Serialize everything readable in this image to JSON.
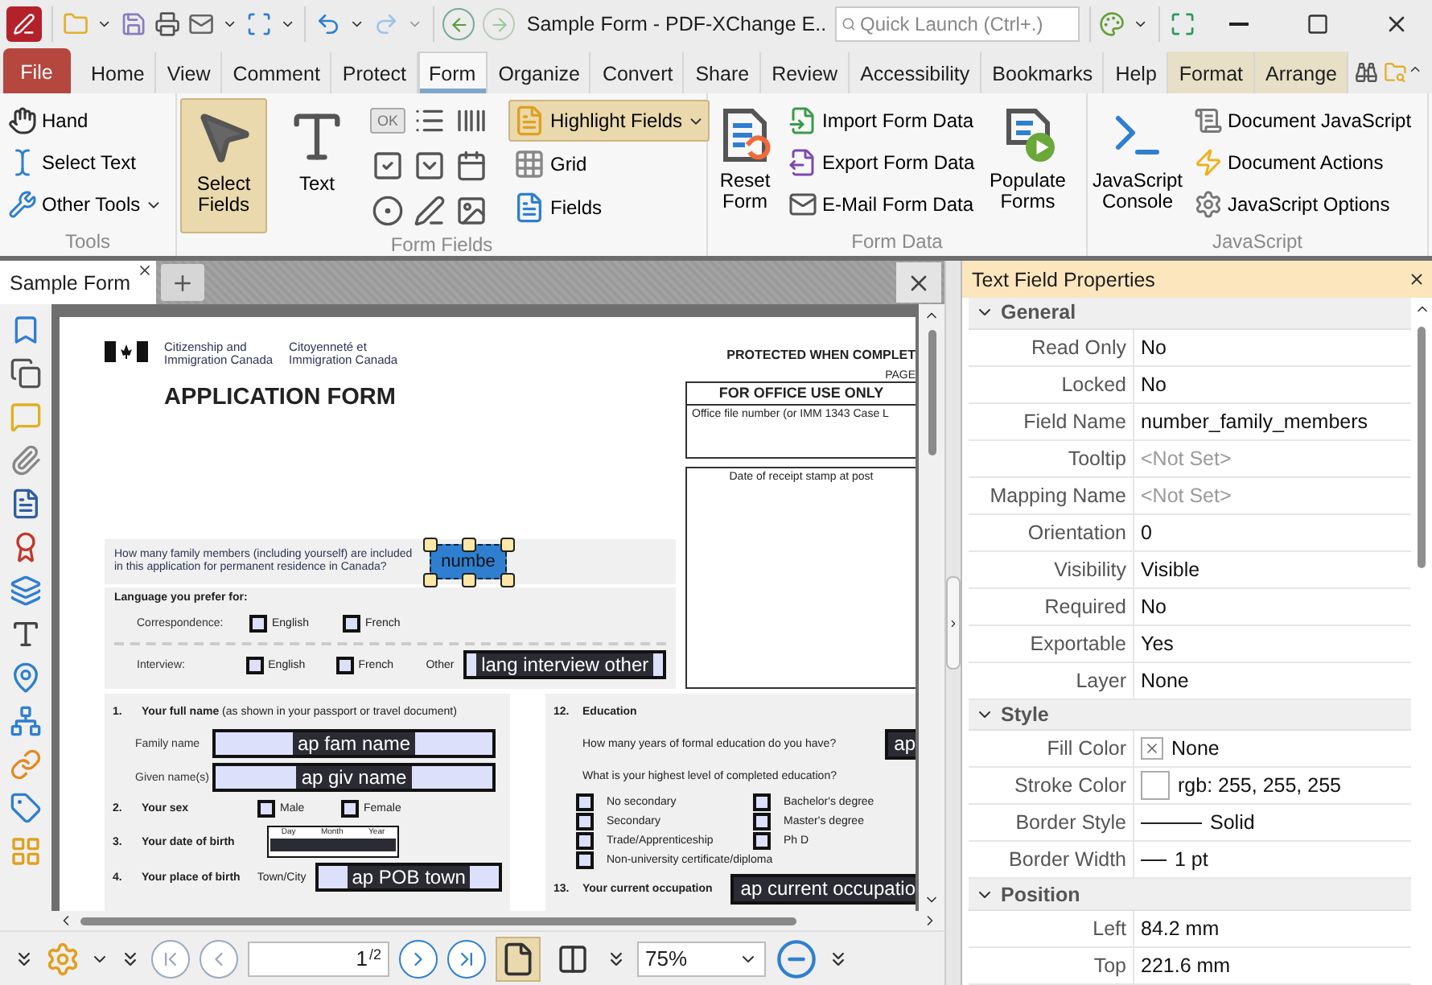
{
  "window": {
    "title": "Sample Form - PDF-XChange E..",
    "quick_launch": {
      "placeholder": "Quick Launch (Ctrl+.)"
    }
  },
  "menu_tabs": [
    {
      "label": "File",
      "kind": "file",
      "selected": false
    },
    {
      "label": "Home",
      "kind": "tab",
      "selected": false
    },
    {
      "label": "View",
      "kind": "tab",
      "selected": false
    },
    {
      "label": "Comment",
      "kind": "tab",
      "selected": false
    },
    {
      "label": "Protect",
      "kind": "tab",
      "selected": false
    },
    {
      "label": "Form",
      "kind": "tab",
      "selected": true
    },
    {
      "label": "Organize",
      "kind": "tab",
      "selected": false
    },
    {
      "label": "Convert",
      "kind": "tab",
      "selected": false
    },
    {
      "label": "Share",
      "kind": "tab",
      "selected": false
    },
    {
      "label": "Review",
      "kind": "tab",
      "selected": false
    },
    {
      "label": "Accessibility",
      "kind": "tab",
      "selected": false
    },
    {
      "label": "Bookmarks",
      "kind": "tab",
      "selected": false
    },
    {
      "label": "Help",
      "kind": "tab",
      "selected": false
    },
    {
      "label": "Format",
      "kind": "context",
      "selected": false
    },
    {
      "label": "Arrange",
      "kind": "context",
      "selected": false
    }
  ],
  "ribbon": {
    "tools": {
      "title": "Tools",
      "hand": {
        "label": "Hand"
      },
      "select_text": {
        "label": "Select Text"
      },
      "other_tools": {
        "label": "Other Tools"
      }
    },
    "form_fields": {
      "title": "Form Fields",
      "select_fields": {
        "label": "Select Fields",
        "selected": true
      },
      "text": {
        "label": "Text",
        "selected": false
      },
      "ok_tool": {
        "label": "OK"
      },
      "highlight_fields": {
        "label": "Highlight Fields",
        "on": true
      },
      "grid": {
        "label": "Grid",
        "on": false
      },
      "fields": {
        "label": "Fields"
      }
    },
    "form_data": {
      "title": "Form Data",
      "reset": {
        "label": "Reset Form"
      },
      "import": {
        "label": "Import Form Data"
      },
      "export": {
        "label": "Export Form Data"
      },
      "email": {
        "label": "E-Mail Form Data"
      },
      "populate": {
        "label": "Populate Forms"
      }
    },
    "javascript": {
      "title": "JavaScript",
      "console": {
        "label": "JavaScript Console"
      },
      "document_javascript": {
        "label": "Document JavaScript"
      },
      "document_actions": {
        "label": "Document Actions"
      },
      "options": {
        "label": "JavaScript Options"
      }
    }
  },
  "document_tabs": [
    {
      "label": "Sample Form",
      "selected": true
    }
  ],
  "page": {
    "agency_en": [
      "Citizenship and",
      "Immigration Canada"
    ],
    "agency_fr": [
      "Citoyenneté et",
      "Immigration Canada"
    ],
    "protected": "PROTECTED WHEN COMPLET",
    "page_label": "PAGE",
    "title": "APPLICATION FORM",
    "office_box": {
      "heading": "FOR OFFICE USE ONLY",
      "file_number": "Office file number (or IMM 1343 Case L",
      "stamp": "Date of receipt stamp at post"
    },
    "family_question": {
      "text": "How many family members (including yourself) are included in this application for permanent residence in Canada?",
      "value": "numbe",
      "selected": true
    },
    "language": {
      "heading": "Language you prefer for:",
      "rows": [
        {
          "label": "Correspondence:",
          "options": [
            {
              "label": "English",
              "checked": false
            },
            {
              "label": "French",
              "checked": false
            }
          ]
        },
        {
          "label": "Interview:",
          "options": [
            {
              "label": "English",
              "checked": false
            },
            {
              "label": "French",
              "checked": false
            }
          ],
          "other_label": "Other",
          "other_value": "lang interview other"
        }
      ]
    },
    "personal": [
      {
        "number": "1.",
        "title": "**Your full name** (as shown in your passport or travel document)",
        "kind": "heading"
      },
      {
        "label": "Family name",
        "value": "ap fam name",
        "kind": "field"
      },
      {
        "label": "Given name(s)",
        "value": "ap giv name",
        "kind": "field"
      },
      {
        "number": "2.",
        "title": "**Your sex**",
        "kind": "choices",
        "options": [
          {
            "label": "Male",
            "checked": false
          },
          {
            "label": "Female",
            "checked": false
          }
        ]
      },
      {
        "number": "3.",
        "title": "**Your date of birth**",
        "kind": "date",
        "parts": [
          "Day",
          "Month",
          "Year"
        ]
      },
      {
        "number": "4.",
        "title": "**Your place of birth**",
        "kind": "place",
        "label": "Town/City",
        "value": "ap POB town"
      }
    ],
    "education": {
      "number": "12.",
      "title": "Education",
      "years_question": "How many years of formal education do you have?",
      "years_value": "ap",
      "level_question": "What is your highest level of completed education?",
      "options_left": [
        {
          "label": "No secondary",
          "checked": false
        },
        {
          "label": "Secondary",
          "checked": false
        },
        {
          "label": "Trade/Apprenticeship",
          "checked": false
        },
        {
          "label": "Non-university certificate/diploma",
          "checked": false
        }
      ],
      "options_right": [
        {
          "label": "Bachelor's degree",
          "checked": false
        },
        {
          "label": "Master's degree",
          "checked": false
        },
        {
          "label": "Ph D",
          "checked": false
        }
      ]
    },
    "occupation": {
      "number": "13.",
      "title": "Your current occupation",
      "value": "ap current occupatio"
    }
  },
  "navigation": {
    "page": "1",
    "of": "/2",
    "zoom": "75%"
  },
  "properties": {
    "title": "Text Field Properties",
    "sections": [
      {
        "title": "General",
        "expanded": true,
        "rows": [
          {
            "name": "Read Only",
            "value": "No",
            "kind": "text"
          },
          {
            "name": "Locked",
            "value": "No",
            "kind": "text"
          },
          {
            "name": "Field Name",
            "value": "number_family_members",
            "kind": "text"
          },
          {
            "name": "Tooltip",
            "value": "<Not Set>",
            "kind": "unset"
          },
          {
            "name": "Mapping Name",
            "value": "<Not Set>",
            "kind": "unset"
          },
          {
            "name": "Orientation",
            "value": "0",
            "kind": "text"
          },
          {
            "name": "Visibility",
            "value": "Visible",
            "kind": "text"
          },
          {
            "name": "Required",
            "value": "No",
            "kind": "text"
          },
          {
            "name": "Exportable",
            "value": "Yes",
            "kind": "text"
          },
          {
            "name": "Layer",
            "value": "None",
            "kind": "text"
          }
        ]
      },
      {
        "title": "Style",
        "expanded": true,
        "rows": [
          {
            "name": "Fill Color",
            "value": "None",
            "kind": "no_fill"
          },
          {
            "name": "Stroke Color",
            "value": "rgb: 255, 255, 255",
            "kind": "swatch"
          },
          {
            "name": "Border Style",
            "value": "Solid",
            "kind": "long_line"
          },
          {
            "name": "Border Width",
            "value": "1 pt",
            "kind": "short_line"
          }
        ]
      },
      {
        "title": "Position",
        "expanded": true,
        "rows": [
          {
            "name": "Left",
            "value": "84.2 mm",
            "kind": "text"
          },
          {
            "name": "Top",
            "value": "221.6 mm",
            "kind": "text"
          }
        ]
      }
    ]
  }
}
